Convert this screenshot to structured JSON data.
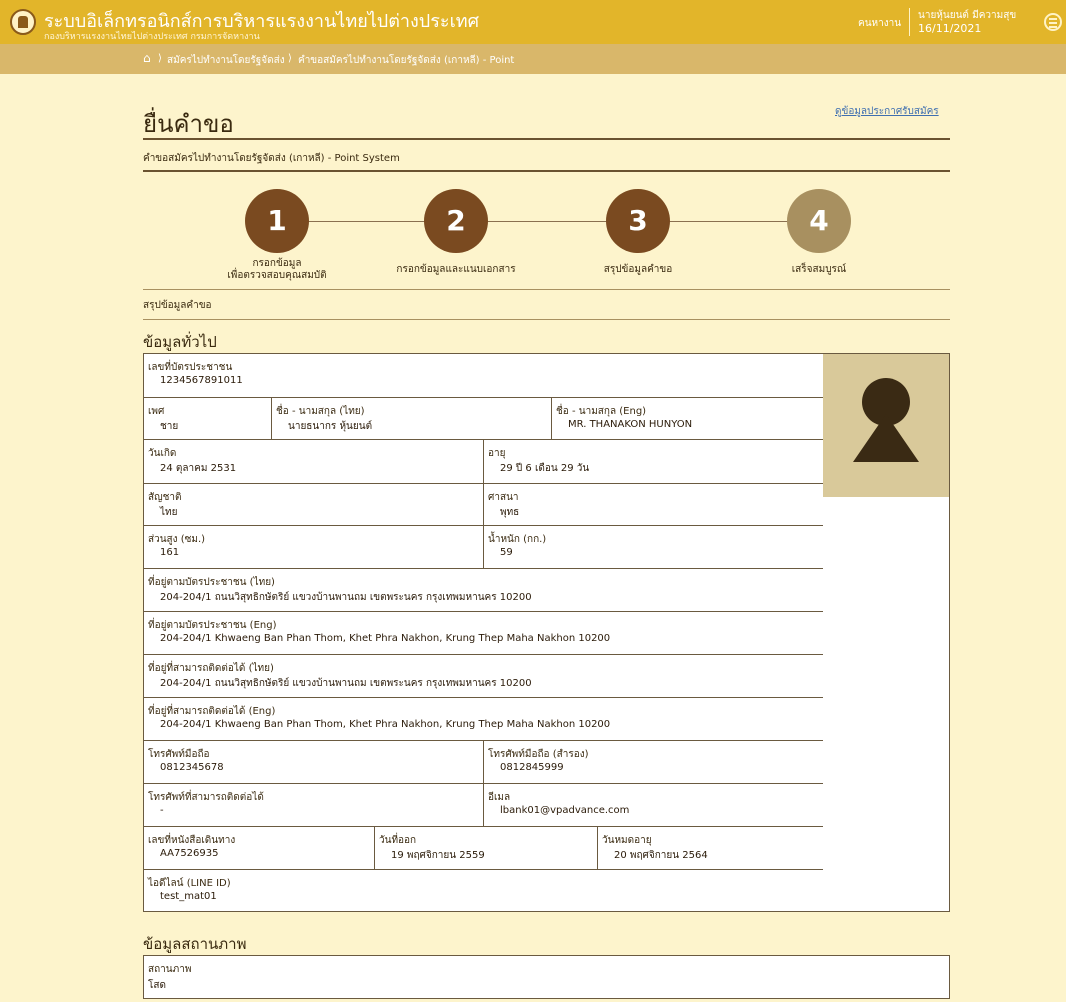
{
  "header": {
    "app_title": "ระบบอิเล็กทรอนิกส์การบริหารแรงงานไทยไปต่างประเทศ",
    "app_subtitle": "กองบริหารแรงงานไทยไปต่างประเทศ กรมการจัดหางาน",
    "role": "คนหางาน",
    "user_name": "นายหุ้นยนต์ มีความสุข",
    "date": "16/11/2021"
  },
  "breadcrumb": {
    "home_icon": "home-icon",
    "item1": "สมัครไปทำงานโดยรัฐจัดส่ง",
    "item2": "คำขอสมัครไปทำงานโดยรัฐจัดส่ง (เกาหลี) - Point"
  },
  "page": {
    "title": "ยื่นคำขอ",
    "top_link": "ดูข้อมูลประกาศรับสมัคร",
    "subtitle": "คำขอสมัครไปทำงานโดยรัฐจัดส่ง (เกาหลี) - Point System"
  },
  "steps": [
    {
      "num": "1",
      "line1": "กรอกข้อมูล",
      "line2": "เพื่อตรวจสอบคุณสมบัติ"
    },
    {
      "num": "2",
      "line1": "กรอกข้อมูลและแนบเอกสาร",
      "line2": ""
    },
    {
      "num": "3",
      "line1": "สรุปข้อมูลคำขอ",
      "line2": ""
    },
    {
      "num": "4",
      "line1": "เสร็จสมบูรณ์",
      "line2": ""
    }
  ],
  "summary_label": "สรุปข้อมูลคำขอ",
  "general": {
    "heading": "ข้อมูลทั่วไป",
    "id_label": "เลขที่บัตรประชาชน",
    "id_value": "1234567891011",
    "gender_label": "เพศ",
    "gender_value": "ชาย",
    "name_th_label": "ชื่อ - นามสกุล (ไทย)",
    "name_th_value": "นายธนากร หุ้นยนต์",
    "name_en_label": "ชื่อ - นามสกุล (Eng)",
    "name_en_value": "MR. THANAKON HUNYON",
    "dob_label": "วันเกิด",
    "dob_value": "24 ตุลาคม 2531",
    "age_label": "อายุ",
    "age_value": "29 ปี 6 เดือน 29 วัน",
    "nationality_label": "สัญชาติ",
    "nationality_value": "ไทย",
    "religion_label": "ศาสนา",
    "religion_value": "พุทธ",
    "height_label": "ส่วนสูง (ซม.)",
    "height_value": "161",
    "weight_label": "น้ำหนัก (กก.)",
    "weight_value": "59",
    "addr_id_th_label": "ที่อยู่ตามบัตรประชาชน (ไทย)",
    "addr_id_th_value": "204-204/1 ถนนวิสุทธิกษัตริย์ แขวงบ้านพานถม เขตพระนคร กรุงเทพมหานคร 10200",
    "addr_id_en_label": "ที่อยู่ตามบัตรประชาชน (Eng)",
    "addr_id_en_value": "204-204/1 Khwaeng Ban Phan Thom, Khet Phra Nakhon, Krung Thep Maha Nakhon 10200",
    "addr_contact_th_label": "ที่อยู่ที่สามารถติดต่อได้ (ไทย)",
    "addr_contact_th_value": "204-204/1 ถนนวิสุทธิกษัตริย์ แขวงบ้านพานถม เขตพระนคร กรุงเทพมหานคร 10200",
    "addr_contact_en_label": "ที่อยู่ที่สามารถติดต่อได้ (Eng)",
    "addr_contact_en_value": "204-204/1 Khwaeng Ban Phan Thom, Khet Phra Nakhon, Krung Thep Maha Nakhon 10200",
    "mobile_label": "โทรศัพท์มือถือ",
    "mobile_value": "0812345678",
    "mobile_alt_label": "โทรศัพท์มือถือ (สำรอง)",
    "mobile_alt_value": "0812845999",
    "contact_phone_label": "โทรศัพท์ที่สามารถติดต่อได้",
    "contact_phone_value": "-",
    "email_label": "อีเมล",
    "email_value": "lbank01@vpadvance.com",
    "passport_label": "เลขที่หนังสือเดินทาง",
    "passport_value": "AA7526935",
    "issue_label": "วันที่ออก",
    "issue_value": "19 พฤศจิกายน 2559",
    "expire_label": "วันหมดอายุ",
    "expire_value": "20 พฤศจิกายน 2564",
    "line_label": "ไอดีไลน์ (LINE ID)",
    "line_value": "test_mat01"
  },
  "status": {
    "heading": "ข้อมูลสถานภาพ",
    "label": "สถานภาพ",
    "value": "โสด"
  },
  "colors": {
    "topbar": "#e2b52a",
    "breadbar": "#d9b76a",
    "background": "#fdf4cc",
    "step_done": "#7a4a20",
    "step_todo": "#a89060",
    "link": "#3f6fb0"
  }
}
